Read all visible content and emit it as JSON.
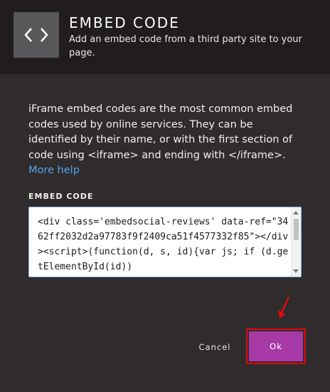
{
  "header": {
    "icon": "code-brackets-icon",
    "title": "EMBED CODE",
    "subtitle": "Add an embed code from a third party site to your page."
  },
  "intro": {
    "text": "iFrame embed codes are the most common embed codes used by online services. They can be identified by their name, or with the first section of code using <iframe> and ending with </iframe>.",
    "link": "More help"
  },
  "embed_field": {
    "label": "EMBED CODE",
    "value": "<div class='embedsocial-reviews' data-ref=\"3462ff2032d2a97783f9f2409ca51f4577332f85\"></div><script>(function(d, s, id){var js; if (d.getElementById(id))"
  },
  "actions": {
    "cancel": "Cancel",
    "ok": "Ok"
  },
  "annotation": {
    "color": "#e00b0b"
  },
  "colors": {
    "header_bg": "#211d1e",
    "body_bg": "#302b2c",
    "link": "#56a4ec",
    "primary_button": "#a73aa6"
  }
}
